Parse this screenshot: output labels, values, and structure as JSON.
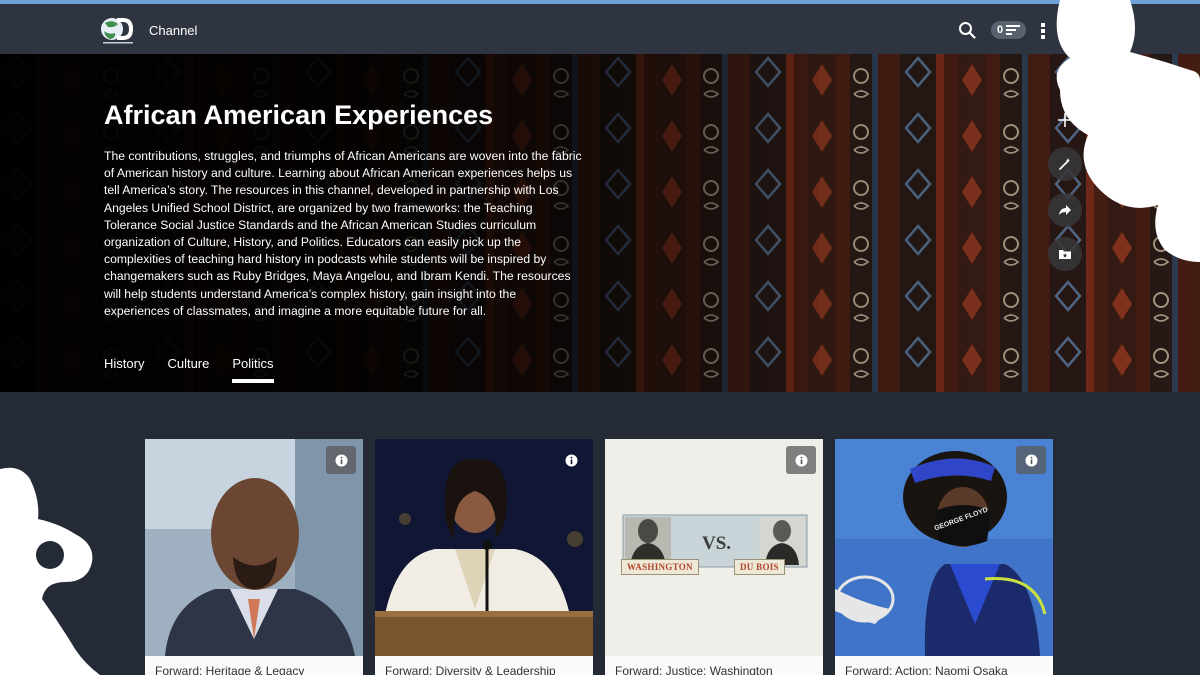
{
  "nav": {
    "title": "Channel",
    "playlist_count": "0",
    "icons": [
      "discovery-education-logo",
      "search-icon",
      "playlist-icon",
      "more-vertical-icon"
    ]
  },
  "hero": {
    "title": "African American Experiences",
    "description_lines": [
      "The contributions, struggles, and triumphs of African Americans are woven into the fabric",
      "of American history and culture. Learning about African American experiences helps us",
      "tell America’s story. The resources in this channel, developed in partnership with Los",
      "Angeles Unified School District, are organized by two frameworks: the Teaching",
      "Tolerance Social Justice Standards and the African American Studies curriculum",
      "organization of Culture, History, and Politics. Educators can easily pick up the",
      "complexities of teaching hard history in podcasts while students will be inspired by",
      "changemakers such as Ruby Bridges, Maya Angelou, and Ibram Kendi. The resources",
      "will help students understand America’s complex history, gain insight into the",
      "experiences of classmates, and imagine a more equitable future for all."
    ],
    "tabs": [
      {
        "label": "History",
        "active": false
      },
      {
        "label": "Culture",
        "active": false
      },
      {
        "label": "Politics",
        "active": true
      }
    ],
    "actions": [
      "plus-icon",
      "magic-wand-icon",
      "share-icon",
      "folder-icon"
    ]
  },
  "cards": [
    {
      "footer": "Forward: Heritage & Legacy",
      "image": "man-in-suit-interview"
    },
    {
      "footer": "Forward: Diversity & Leadership",
      "image": "woman-at-podium"
    },
    {
      "footer": "Forward: Justice: Washington",
      "image": "washington-vs-du-bois"
    },
    {
      "footer": "Forward: Action: Naomi Osaka",
      "image": "tennis-player-mask"
    }
  ],
  "vs_graphic": {
    "left_name": "WASHINGTON",
    "right_name": "DU BOIS",
    "vs": "VS."
  },
  "mask_text": "GEORGE FLOYD",
  "colors": {
    "accent_line": "#6f9fd8",
    "nav_bg": "#2f3540",
    "page_bg": "#252b36",
    "vs_label": "#b2432a"
  }
}
